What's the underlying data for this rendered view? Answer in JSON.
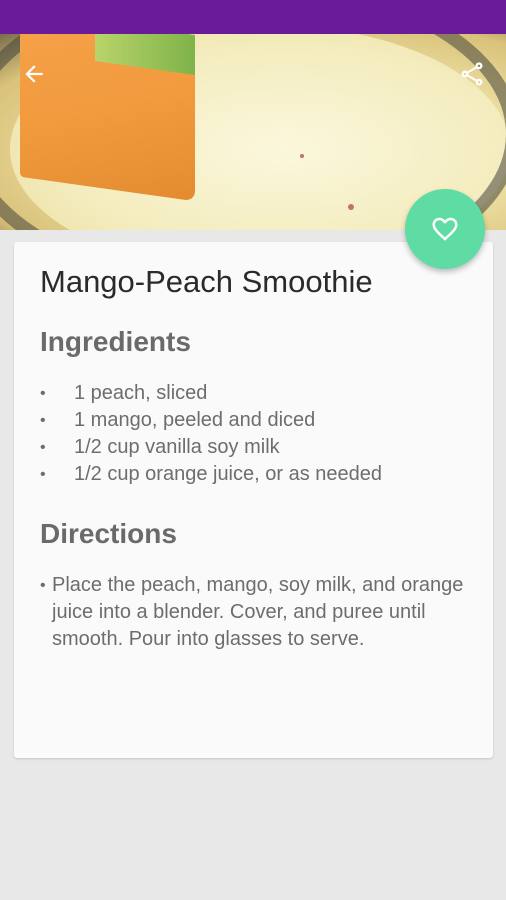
{
  "recipe": {
    "title": "Mango-Peach Smoothie",
    "ingredients_heading": "Ingredients",
    "ingredients": [
      "1 peach, sliced",
      "1 mango, peeled and diced",
      "1/2 cup vanilla soy milk",
      "1/2 cup orange juice, or as needed"
    ],
    "directions_heading": "Directions",
    "directions": [
      "Place the peach, mango, soy milk, and orange juice into a blender. Cover, and puree until smooth. Pour into glasses to serve."
    ]
  },
  "icons": {
    "back": "arrow-back-icon",
    "share": "share-icon",
    "favorite": "heart-outline-icon"
  },
  "colors": {
    "status_bar": "#6a1b9a",
    "fab": "#5edca4",
    "background": "#e8e8e8",
    "card": "#fafafa"
  }
}
